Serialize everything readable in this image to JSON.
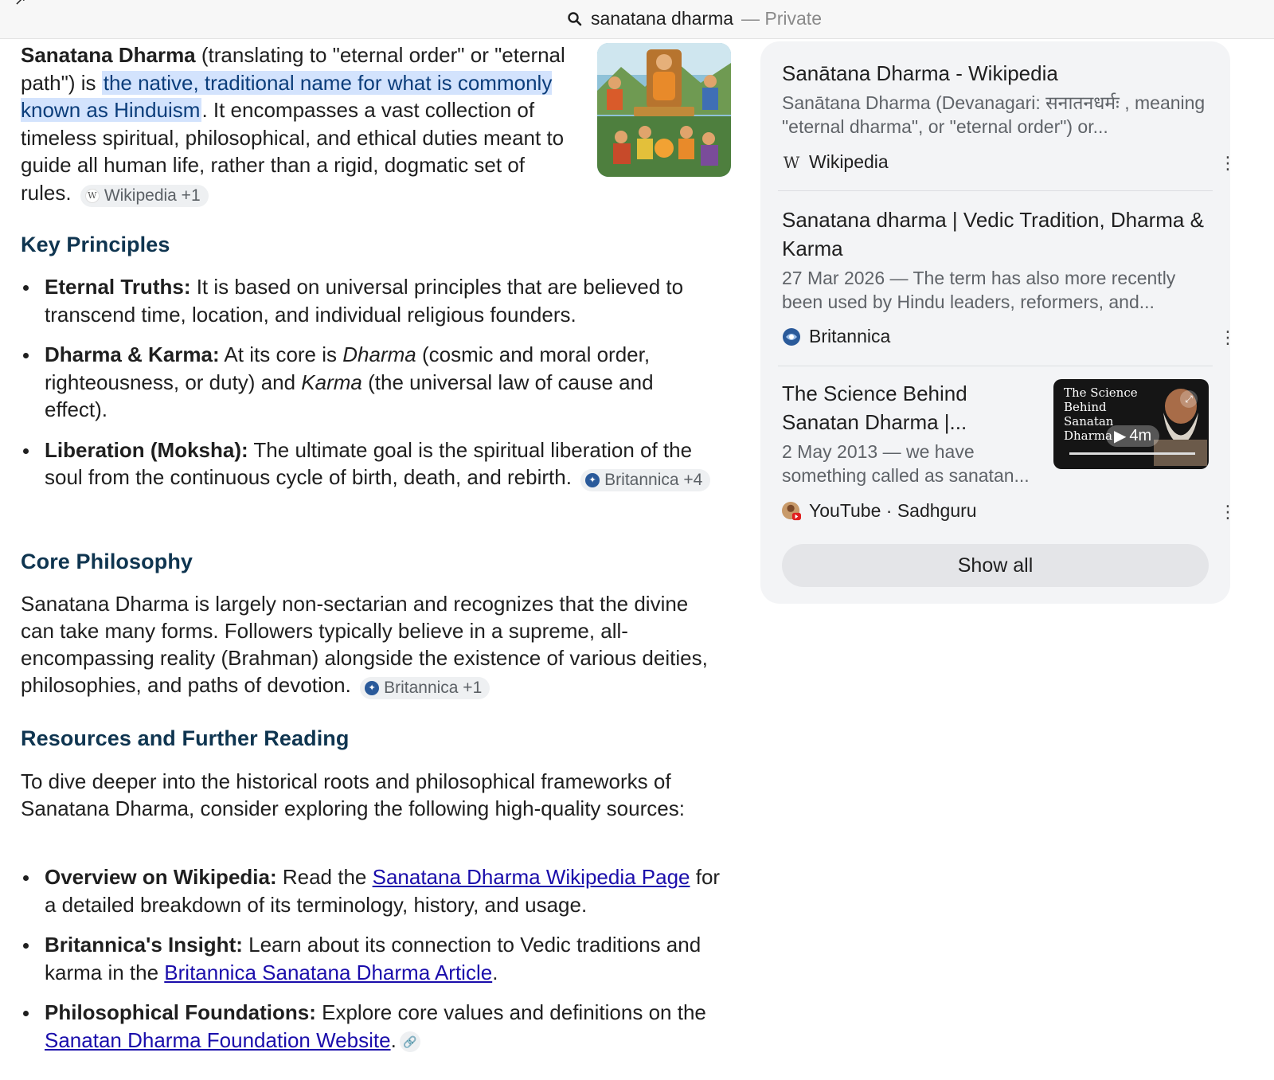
{
  "topbar": {
    "query": "sanatana dharma",
    "mode": "— Private"
  },
  "intro": {
    "bold": "Sanatana Dharma",
    "t1": " (translating to \"eternal order\" or \"eternal path\") is ",
    "highlight": "the native, traditional name for what is commonly known as Hinduism",
    "t2": ". It encompasses a vast collection of timeless spiritual, philosophical, and ethical duties meant to guide all human life, rather than a rigid, dogmatic set of rules.",
    "chip": "Wikipedia +1",
    "image_caption": "Indian Vedic Culture"
  },
  "key_principles": {
    "heading": "Key Principles",
    "items": [
      {
        "term": "Eternal Truths:",
        "text": " It is based on universal principles that are believed to transcend time, location, and individual religious founders."
      },
      {
        "term": "Dharma & Karma:",
        "t1": " At its core is ",
        "i1": "Dharma",
        "t2": " (cosmic and moral order, righteousness, or duty) and ",
        "i2": "Karma",
        "t3": " (the universal law of cause and effect)."
      },
      {
        "term": "Liberation (Moksha):",
        "text": " The ultimate goal is the spiritual liberation of the soul from the continuous cycle of birth, death, and rebirth.",
        "chip": "Britannica +4"
      }
    ]
  },
  "core_philosophy": {
    "heading": "Core Philosophy",
    "text": "Sanatana Dharma is largely non-sectarian and recognizes that the divine can take many forms. Followers typically believe in a supreme, all-encompassing reality (Brahman) alongside the existence of various deities, philosophies, and paths of devotion.",
    "chip": "Britannica +1"
  },
  "resources": {
    "heading": "Resources and Further Reading",
    "intro": "To dive deeper into the historical roots and philosophical frameworks of Sanatana Dharma, consider exploring the following high-quality sources:",
    "items": [
      {
        "term": "Overview on Wikipedia:",
        "pre": " Read the ",
        "link": "Sanatana Dharma Wikipedia Page",
        "post": " for a detailed breakdown of its terminology, history, and usage."
      },
      {
        "term": "Britannica's Insight:",
        "pre": " Learn about its connection to Vedic traditions and karma in the ",
        "link": "Britannica Sanatana Dharma Article",
        "post": "."
      },
      {
        "term": "Philosophical Foundations:",
        "pre": " Explore core values and definitions on the ",
        "link": "Sanatan Dharma Foundation Website",
        "post": "."
      }
    ]
  },
  "panel": {
    "cards": [
      {
        "title": "Sanātana Dharma - Wikipedia",
        "snippet": "Sanātana Dharma (Devanagari: सनातनधर्मः , meaning \"eternal dharma\", or \"eternal order\") or...",
        "source": "Wikipedia",
        "source_icon": "W"
      },
      {
        "title": "Sanatana dharma | Vedic Tradition, Dharma & Karma",
        "snippet": "27 Mar 2026 — The term has also more recently been used by Hindu leaders, reformers, and...",
        "source": "Britannica",
        "source_icon": "globe-icon"
      },
      {
        "title": "The Science Behind Sanatan Dharma |...",
        "snippet": "2 May 2013 — we have something called as sanatan...",
        "source": "YouTube · Sadhguru",
        "video_title": "The Science Behind Sanatan Dharma",
        "duration": "4m"
      }
    ],
    "show_all": "Show all"
  },
  "colors": {
    "highlight_bg": "#d3e3fd",
    "heading": "#0f3550",
    "link": "#1a0dab",
    "panel_bg": "#f3f4f6"
  }
}
